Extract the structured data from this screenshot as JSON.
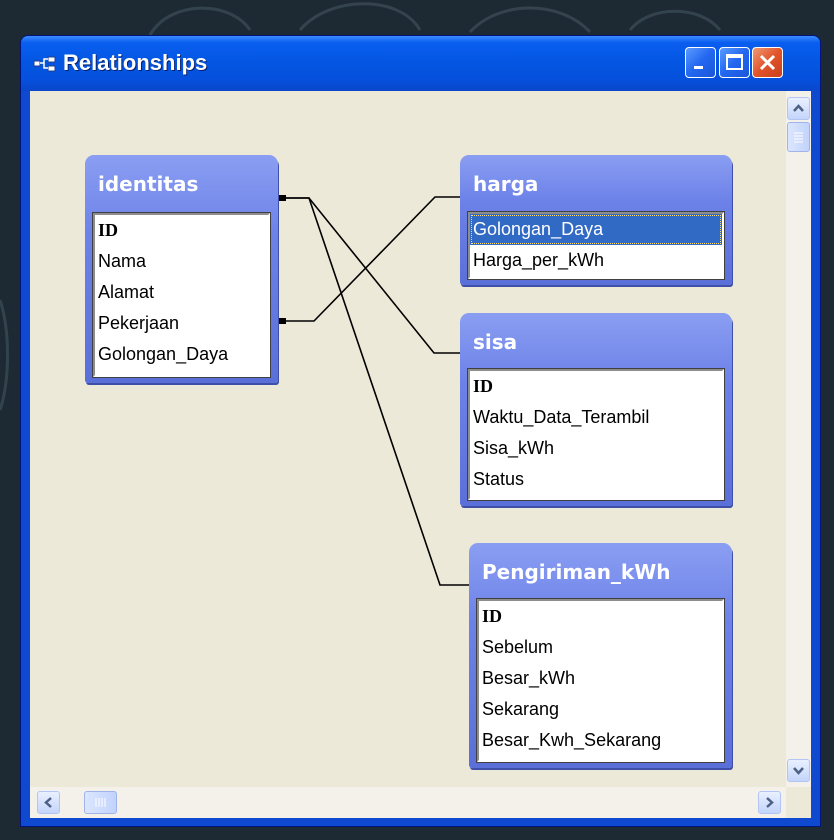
{
  "window": {
    "title": "Relationships",
    "icon": "relationships-icon"
  },
  "titlebar_buttons": {
    "minimize": "minimize-icon",
    "maximize": "maximize-icon",
    "close": "close-icon"
  },
  "tables": {
    "identitas": {
      "name": "identitas",
      "fields": [
        "ID",
        "Nama",
        "Alamat",
        "Pekerjaan",
        "Golongan_Daya"
      ]
    },
    "harga": {
      "name": "harga",
      "fields": [
        "Golongan_Daya",
        "Harga_per_kWh"
      ],
      "selected_field": "Golongan_Daya"
    },
    "sisa": {
      "name": "sisa",
      "fields": [
        "ID",
        "Waktu_Data_Terambil",
        "Sisa_kWh",
        "Status"
      ]
    },
    "pengiriman": {
      "name": "Pengiriman_kWh",
      "fields": [
        "ID",
        "Sebelum",
        "Besar_kWh",
        "Sekarang",
        "Besar_Kwh_Sekarang"
      ]
    }
  },
  "relationships": [
    {
      "from": "identitas.ID",
      "to": "sisa.ID"
    },
    {
      "from": "identitas.ID",
      "to": "Pengiriman_kWh.ID"
    },
    {
      "from": "identitas.Golongan_Daya",
      "to": "harga.Golongan_Daya"
    }
  ],
  "colors": {
    "titlebar": "#0a5ef0",
    "table_header": "#6d82e8",
    "workspace": "#ece9d8",
    "selection": "#316ac5"
  }
}
